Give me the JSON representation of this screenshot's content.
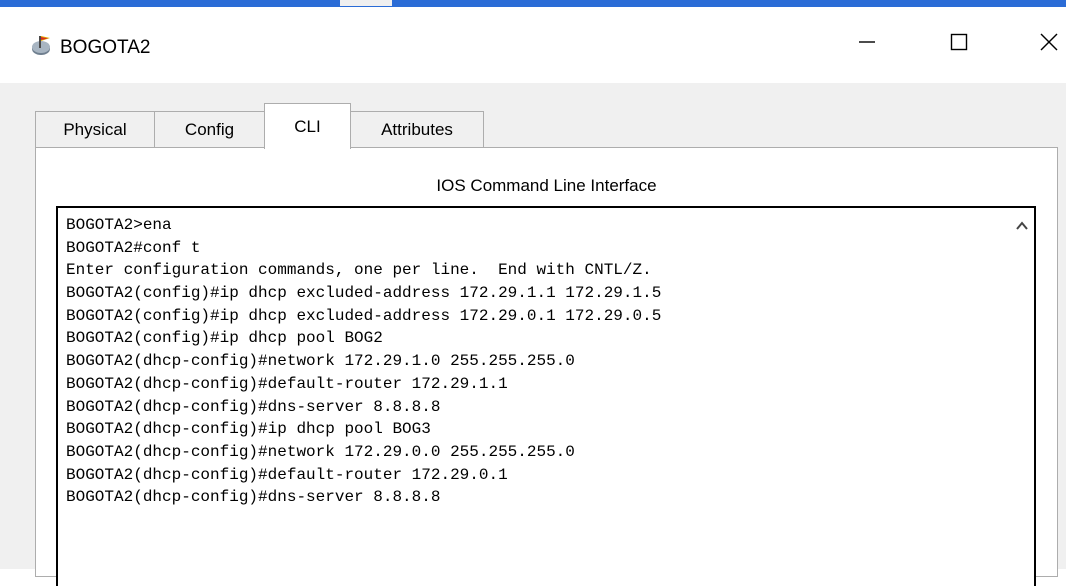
{
  "window": {
    "title": "BOGOTA2",
    "buttons": {
      "minimize": "minimize-icon",
      "maximize": "maximize-icon",
      "close": "close-icon"
    },
    "icon": "packet-tracer-router-icon"
  },
  "tabs": [
    {
      "label": "Physical",
      "active": false
    },
    {
      "label": "Config",
      "active": false
    },
    {
      "label": "CLI",
      "active": true
    },
    {
      "label": "Attributes",
      "active": false
    }
  ],
  "cli": {
    "heading": "IOS Command Line Interface",
    "lines": [
      "BOGOTA2>ena",
      "BOGOTA2#conf t",
      "Enter configuration commands, one per line.  End with CNTL/Z.",
      "BOGOTA2(config)#ip dhcp excluded-address 172.29.1.1 172.29.1.5",
      "BOGOTA2(config)#ip dhcp excluded-address 172.29.0.1 172.29.0.5",
      "BOGOTA2(config)#ip dhcp pool BOG2",
      "BOGOTA2(dhcp-config)#network 172.29.1.0 255.255.255.0",
      "BOGOTA2(dhcp-config)#default-router 172.29.1.1",
      "BOGOTA2(dhcp-config)#dns-server 8.8.8.8",
      "BOGOTA2(dhcp-config)#ip dhcp pool BOG3",
      "BOGOTA2(dhcp-config)#network 172.29.0.0 255.255.255.0",
      "BOGOTA2(dhcp-config)#default-router 172.29.0.1",
      "BOGOTA2(dhcp-config)#dns-server 8.8.8.8"
    ]
  },
  "colors": {
    "accent": "#2b6cd6",
    "tab_border": "#adadad",
    "chrome": "#f0f0f0"
  }
}
